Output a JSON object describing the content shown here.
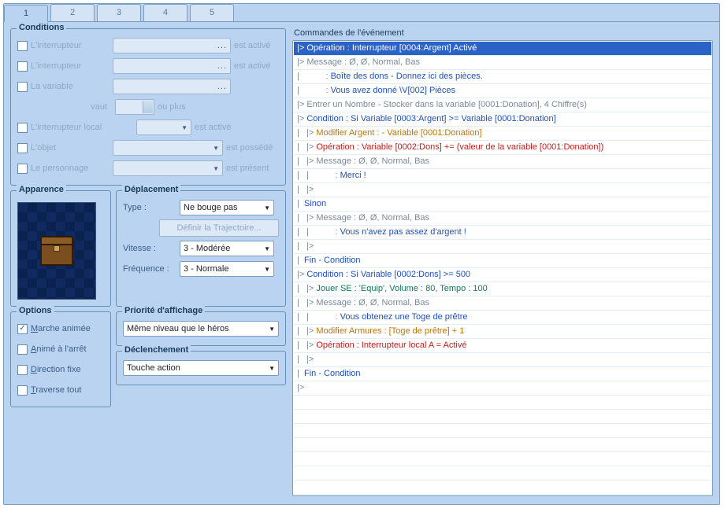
{
  "tabs": [
    "1",
    "2",
    "3",
    "4",
    "5"
  ],
  "active_tab": 0,
  "conditions": {
    "title": "Conditions",
    "switch1_lbl": "L'interrupteur",
    "switch1_suffix": "est activé",
    "switch2_lbl": "L'interrupteur",
    "switch2_suffix": "est activé",
    "variable_lbl": "La variable",
    "variable_mid": "vaut",
    "variable_suffix": "ou plus",
    "selfswitch_lbl": "L'interrupteur local",
    "selfswitch_suffix": "est activé",
    "item_lbl": "L'objet",
    "item_suffix": "est possédé",
    "actor_lbl": "Le personnage",
    "actor_suffix": "est présent"
  },
  "appearance": {
    "title": "Apparence"
  },
  "movement": {
    "title": "Déplacement",
    "type_lbl": "Type :",
    "type_val": "Ne bouge pas",
    "route_btn": "Définir la Trajectoire...",
    "speed_lbl": "Vitesse :",
    "speed_val": "3 - Modérée",
    "freq_lbl": "Fréquence :",
    "freq_val": "3 - Normale"
  },
  "options": {
    "title": "Options",
    "walk": "Marche animée",
    "walk_checked": true,
    "step": "Animé à l'arrêt",
    "fix": "Direction fixe",
    "through": "Traverse tout"
  },
  "priority": {
    "title": "Priorité d'affichage",
    "val": "Même niveau que le héros"
  },
  "trigger": {
    "title": "Déclenchement",
    "val": "Touche action"
  },
  "commands_title": "Commandes de l'événement",
  "commands": [
    {
      "sel": true,
      "parts": [
        [
          "c0",
          "|> "
        ],
        [
          "c3",
          "Opération : Interrupteur [0004:Argent] Activé"
        ]
      ]
    },
    {
      "parts": [
        [
          "c0",
          "|> Message : Ø, Ø, Normal, Bas"
        ]
      ]
    },
    {
      "parts": [
        [
          "c0",
          "|           : "
        ],
        [
          "c1",
          "Boîte des dons - Donnez ici des pièces."
        ]
      ]
    },
    {
      "parts": [
        [
          "c0",
          "|           : "
        ],
        [
          "c1",
          "Vous avez donné \\V[002] Pièces"
        ]
      ]
    },
    {
      "parts": [
        [
          "c0",
          "|> Entrer un Nombre - Stocker dans la variable [0001:Donation], 4 Chiffre(s)"
        ]
      ]
    },
    {
      "parts": [
        [
          "c0",
          "|> "
        ],
        [
          "c1",
          "Condition : Si Variable [0003:Argent] >= Variable [0001:Donation]"
        ]
      ]
    },
    {
      "parts": [
        [
          "c0",
          "|   |> "
        ],
        [
          "c2",
          "Modifier Argent : - Variable [0001:Donation]"
        ]
      ]
    },
    {
      "parts": [
        [
          "c0",
          "|   |> "
        ],
        [
          "c3",
          "Opération : Variable [0002:Dons] += (valeur de la variable [0001:Donation])"
        ]
      ]
    },
    {
      "parts": [
        [
          "c0",
          "|   |> Message : Ø, Ø, Normal, Bas"
        ]
      ]
    },
    {
      "parts": [
        [
          "c0",
          "|   |           : "
        ],
        [
          "c1",
          "Merci !"
        ]
      ]
    },
    {
      "parts": [
        [
          "c0",
          "|   |>"
        ]
      ]
    },
    {
      "parts": [
        [
          "c0",
          "|  "
        ],
        [
          "c1",
          "Sinon"
        ]
      ]
    },
    {
      "parts": [
        [
          "c0",
          "|   |> Message : Ø, Ø, Normal, Bas"
        ]
      ]
    },
    {
      "parts": [
        [
          "c0",
          "|   |           : "
        ],
        [
          "c1",
          "Vous n'avez pas assez d'argent !"
        ]
      ]
    },
    {
      "parts": [
        [
          "c0",
          "|   |>"
        ]
      ]
    },
    {
      "parts": [
        [
          "c0",
          "|  "
        ],
        [
          "c1",
          "Fin - Condition"
        ]
      ]
    },
    {
      "parts": [
        [
          "c0",
          "|> "
        ],
        [
          "c1",
          "Condition : Si Variable [0002:Dons] >= 500"
        ]
      ]
    },
    {
      "parts": [
        [
          "c0",
          "|   |> "
        ],
        [
          "c4",
          "Jouer SE : 'Equip', Volume : 80, Tempo : 100"
        ]
      ]
    },
    {
      "parts": [
        [
          "c0",
          "|   |> Message : Ø, Ø, Normal, Bas"
        ]
      ]
    },
    {
      "parts": [
        [
          "c0",
          "|   |           : "
        ],
        [
          "c1",
          "Vous obtenez une Toge de prêtre"
        ]
      ]
    },
    {
      "parts": [
        [
          "c0",
          "|   |> "
        ],
        [
          "c2",
          "Modifier Armures : [Toge de prêtre] + 1"
        ]
      ]
    },
    {
      "parts": [
        [
          "c0",
          "|   |> "
        ],
        [
          "c3",
          "Opération : Interrupteur local A = Activé"
        ]
      ]
    },
    {
      "parts": [
        [
          "c0",
          "|   |>"
        ]
      ]
    },
    {
      "parts": [
        [
          "c0",
          "|  "
        ],
        [
          "c1",
          "Fin - Condition"
        ]
      ]
    },
    {
      "parts": [
        [
          "c0",
          "|>"
        ]
      ]
    },
    {
      "parts": [
        [
          "c0",
          " "
        ]
      ]
    },
    {
      "parts": [
        [
          "c0",
          " "
        ]
      ]
    },
    {
      "parts": [
        [
          "c0",
          " "
        ]
      ]
    },
    {
      "parts": [
        [
          "c0",
          " "
        ]
      ]
    },
    {
      "parts": [
        [
          "c0",
          " "
        ]
      ]
    },
    {
      "parts": [
        [
          "c0",
          " "
        ]
      ]
    },
    {
      "parts": [
        [
          "c0",
          " "
        ]
      ]
    }
  ]
}
